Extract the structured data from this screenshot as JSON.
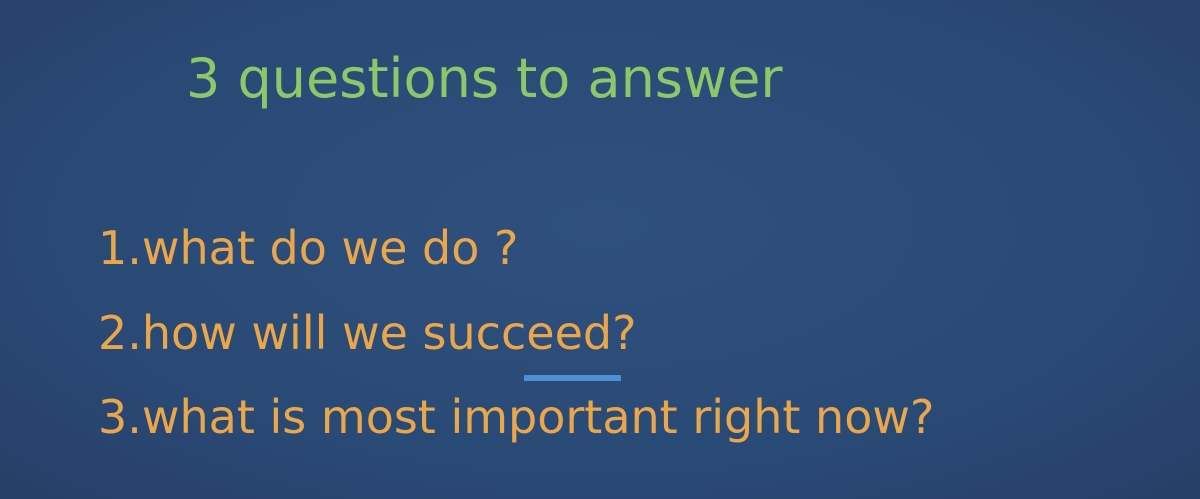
{
  "slide": {
    "title": "3 questions to answer",
    "questions": [
      "1.what do we do ?",
      "2.how will we succeed?",
      "3.what is most important right now?"
    ]
  },
  "colors": {
    "background": "#2b4b78",
    "title": "#8cc86a",
    "questions": "#e9a64a",
    "underline": "#4f8fd6"
  }
}
